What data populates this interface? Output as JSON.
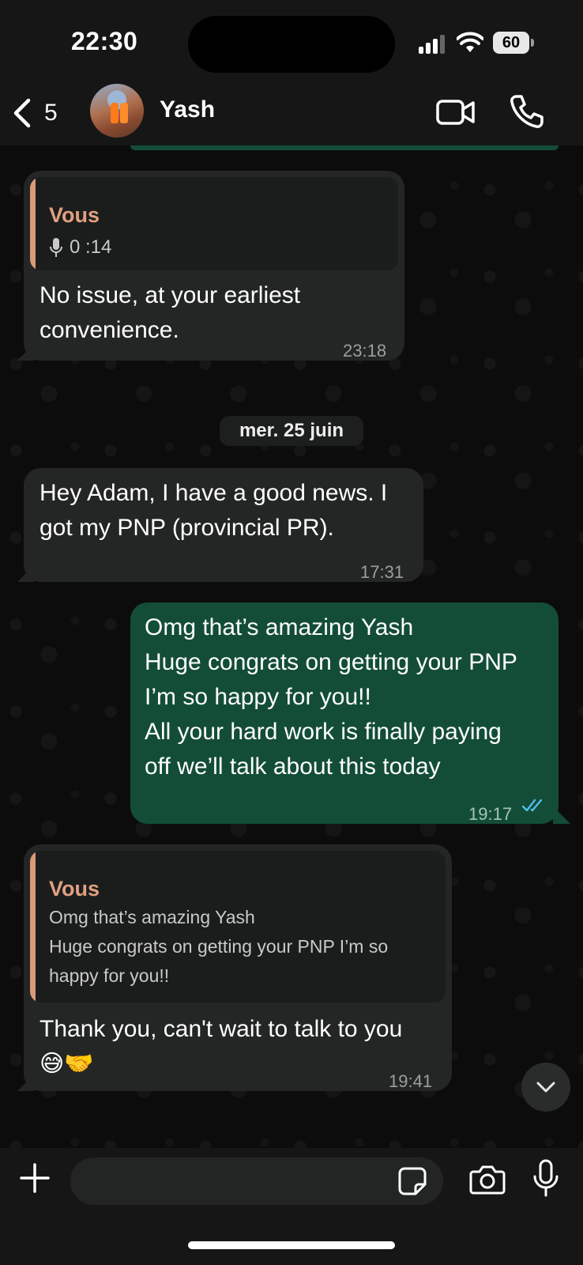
{
  "status_bar": {
    "time": "22:30",
    "battery": "60"
  },
  "header": {
    "back_count": "5",
    "contact_name": "Yash"
  },
  "messages": [
    {
      "direction": "incoming",
      "quote": {
        "author": "Vous",
        "voice_duration": "0 :14"
      },
      "text": "No issue, at your earliest\nconvenience.",
      "time": "23:18"
    },
    {
      "type": "date_separator",
      "label": "mer. 25 juin"
    },
    {
      "direction": "incoming",
      "text": "Hey Adam, I have a good news. I\ngot my PNP (provincial PR).",
      "time": "17:31"
    },
    {
      "direction": "outgoing",
      "text": "Omg that’s amazing Yash\nHuge congrats on getting your PNP\nI’m so happy for you!!\nAll your hard work is finally paying\noff we’ll talk about this today",
      "time": "19:17",
      "status": "read"
    },
    {
      "direction": "incoming",
      "quote": {
        "author": "Vous",
        "text": "Omg that’s amazing Yash\nHuge congrats on getting your PNP I’m so\nhappy for you!!"
      },
      "text": "Thank you, can't wait to talk to you\n😅🤝",
      "time": "19:41"
    }
  ],
  "composer": {
    "placeholder": ""
  },
  "colors": {
    "incoming_bubble": "#242626",
    "outgoing_bubble": "#134d37",
    "quote_accent": "#d99a7a",
    "read_ticks": "#53bdeb"
  },
  "icons": [
    "back-chevron-icon",
    "video-call-icon",
    "phone-call-icon",
    "microphone-icon",
    "double-check-icon",
    "chevron-down-icon",
    "plus-icon",
    "sticker-icon",
    "camera-icon",
    "mic-icon"
  ]
}
